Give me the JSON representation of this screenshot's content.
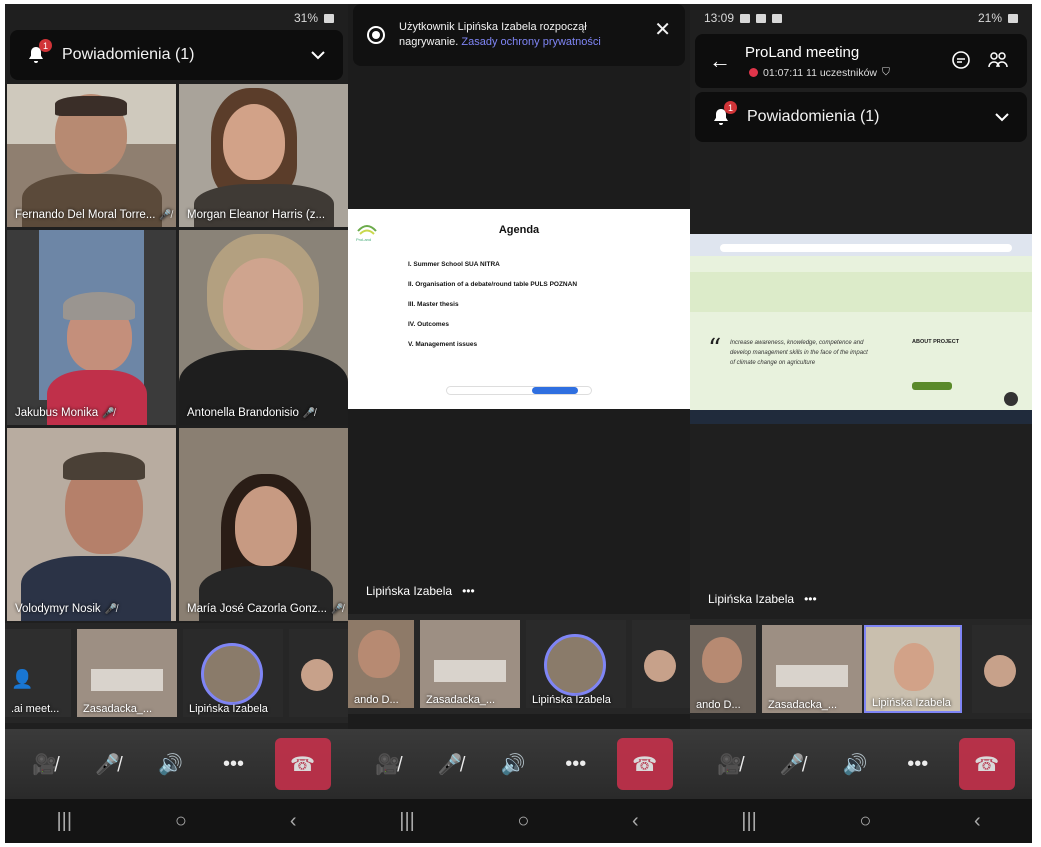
{
  "panel1": {
    "status_battery": "31%",
    "notifications_label": "Powiadomienia (1)",
    "notifications_badge": "1",
    "tiles": [
      {
        "name": "Fernando Del Moral Torre..."
      },
      {
        "name": "Morgan Eleanor Harris (z..."
      },
      {
        "name": "Jakubus Monika"
      },
      {
        "name": "Antonella Brandonisio"
      },
      {
        "name": "Volodymyr Nosik"
      },
      {
        "name": "María José Cazorla Gonz..."
      }
    ],
    "strip": [
      {
        "name": ".ai meet..."
      },
      {
        "name": "Zasadacka_..."
      },
      {
        "name": "Lipińska Izabela"
      }
    ]
  },
  "panel2": {
    "banner_text": "Użytkownik Lipińska Izabela rozpoczął nagrywanie.",
    "banner_link": "Zasady ochrony prywatności",
    "slide_title": "Agenda",
    "slide_items": [
      "I.   Summer School SUA NITRA",
      "II.  Organisation of a debate/round table PULS POZNAN",
      "III. Master thesis",
      "IV.  Outcomes",
      "V.   Management issues"
    ],
    "slide_logo_text": "ProLand",
    "presenter": "Lipińska Izabela",
    "more": "•••",
    "strip": [
      {
        "name": "ando D..."
      },
      {
        "name": "Zasadacka_..."
      },
      {
        "name": "Lipińska Izabela"
      }
    ]
  },
  "panel3": {
    "status_time": "13:09",
    "status_battery": "21%",
    "meeting_title": "ProLand meeting",
    "meeting_sub": "01:07:11 11 uczestników",
    "notifications_label": "Powiadomienia (1)",
    "notifications_badge": "1",
    "shared_quote": "Increase awareness, knowledge, competence and develop management skills in the face of the impact of climate change on agriculture",
    "shared_about": "ABOUT PROJECT",
    "presenter": "Lipińska Izabela",
    "more": "•••",
    "strip": [
      {
        "name": "ando D..."
      },
      {
        "name": "Zasadacka_..."
      },
      {
        "name": "Lipińska Izabela"
      }
    ]
  }
}
